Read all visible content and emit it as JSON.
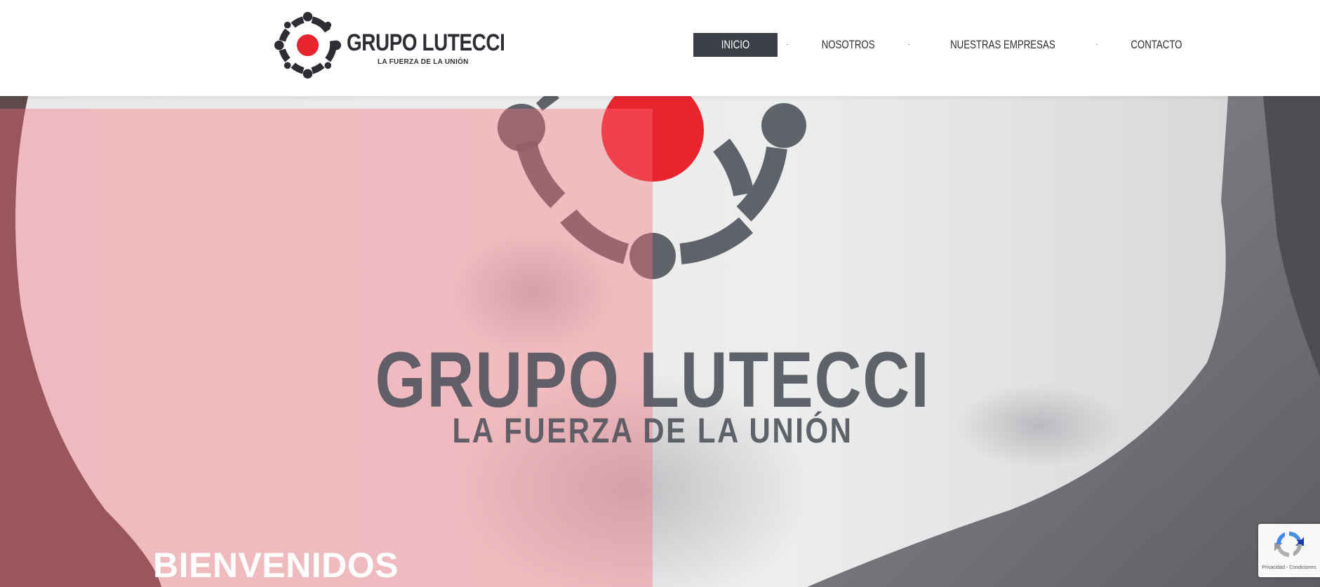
{
  "brand": {
    "name": "GRUPO LUTECCI",
    "tagline": "LA FUERZA DE LA UNIÓN"
  },
  "nav": {
    "items": [
      {
        "label": "INICIO",
        "active": true
      },
      {
        "label": "NOSOTROS",
        "active": false
      },
      {
        "label": "NUESTRAS EMPRESAS",
        "active": false
      },
      {
        "label": "CONTACTO",
        "active": false
      }
    ],
    "separator": "·"
  },
  "hero": {
    "title": "GRUPO LUTECCI",
    "tagline": "LA FUERZA DE LA UNIÓN",
    "welcome": "BIENVENIDOS"
  },
  "recaptcha": {
    "links": "Privacidad - Condiciones"
  },
  "colors": {
    "brand_dark": "#2d2e33",
    "brand_red": "#e8252f",
    "nav_active_bg": "#3c3f47",
    "overlay_pink": "#fa6e78"
  },
  "icons": {
    "logo": "ring-of-dots-logo",
    "recaptcha": "recaptcha-icon"
  }
}
